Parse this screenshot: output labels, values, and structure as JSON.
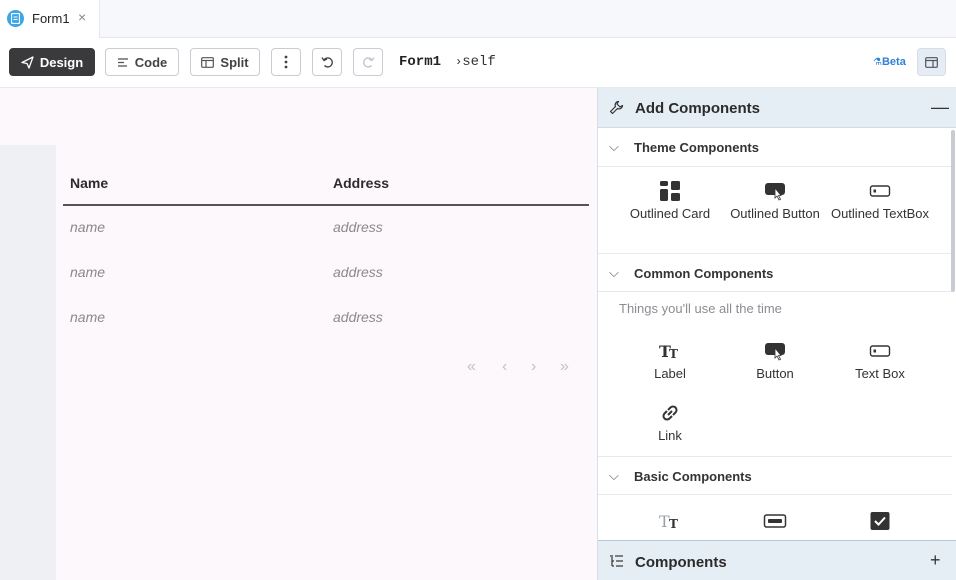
{
  "tab": {
    "title": "Form1",
    "close": "×"
  },
  "toolbar": {
    "design": "Design",
    "code": "Code",
    "split": "Split",
    "form_name": "Form1",
    "self_ref": "self",
    "beta": "Beta"
  },
  "table": {
    "columns": [
      "Name",
      "Address"
    ],
    "rows": [
      [
        "name",
        "address"
      ],
      [
        "name",
        "address"
      ],
      [
        "name",
        "address"
      ]
    ]
  },
  "panel": {
    "title": "Add Components",
    "footer_title": "Components",
    "sections": {
      "theme": {
        "title": "Theme Components",
        "items": [
          "Outlined Card",
          "Outlined Button",
          "Outlined TextBox"
        ]
      },
      "common": {
        "title": "Common Components",
        "note": "Things you'll use all the time",
        "items": [
          "Label",
          "Button",
          "Text Box",
          "Link"
        ]
      },
      "basic": {
        "title": "Basic Components"
      }
    }
  },
  "colors": {
    "accent": "#3aa7e6",
    "primary": "#3a3a3c",
    "beta": "#2f80d8"
  }
}
